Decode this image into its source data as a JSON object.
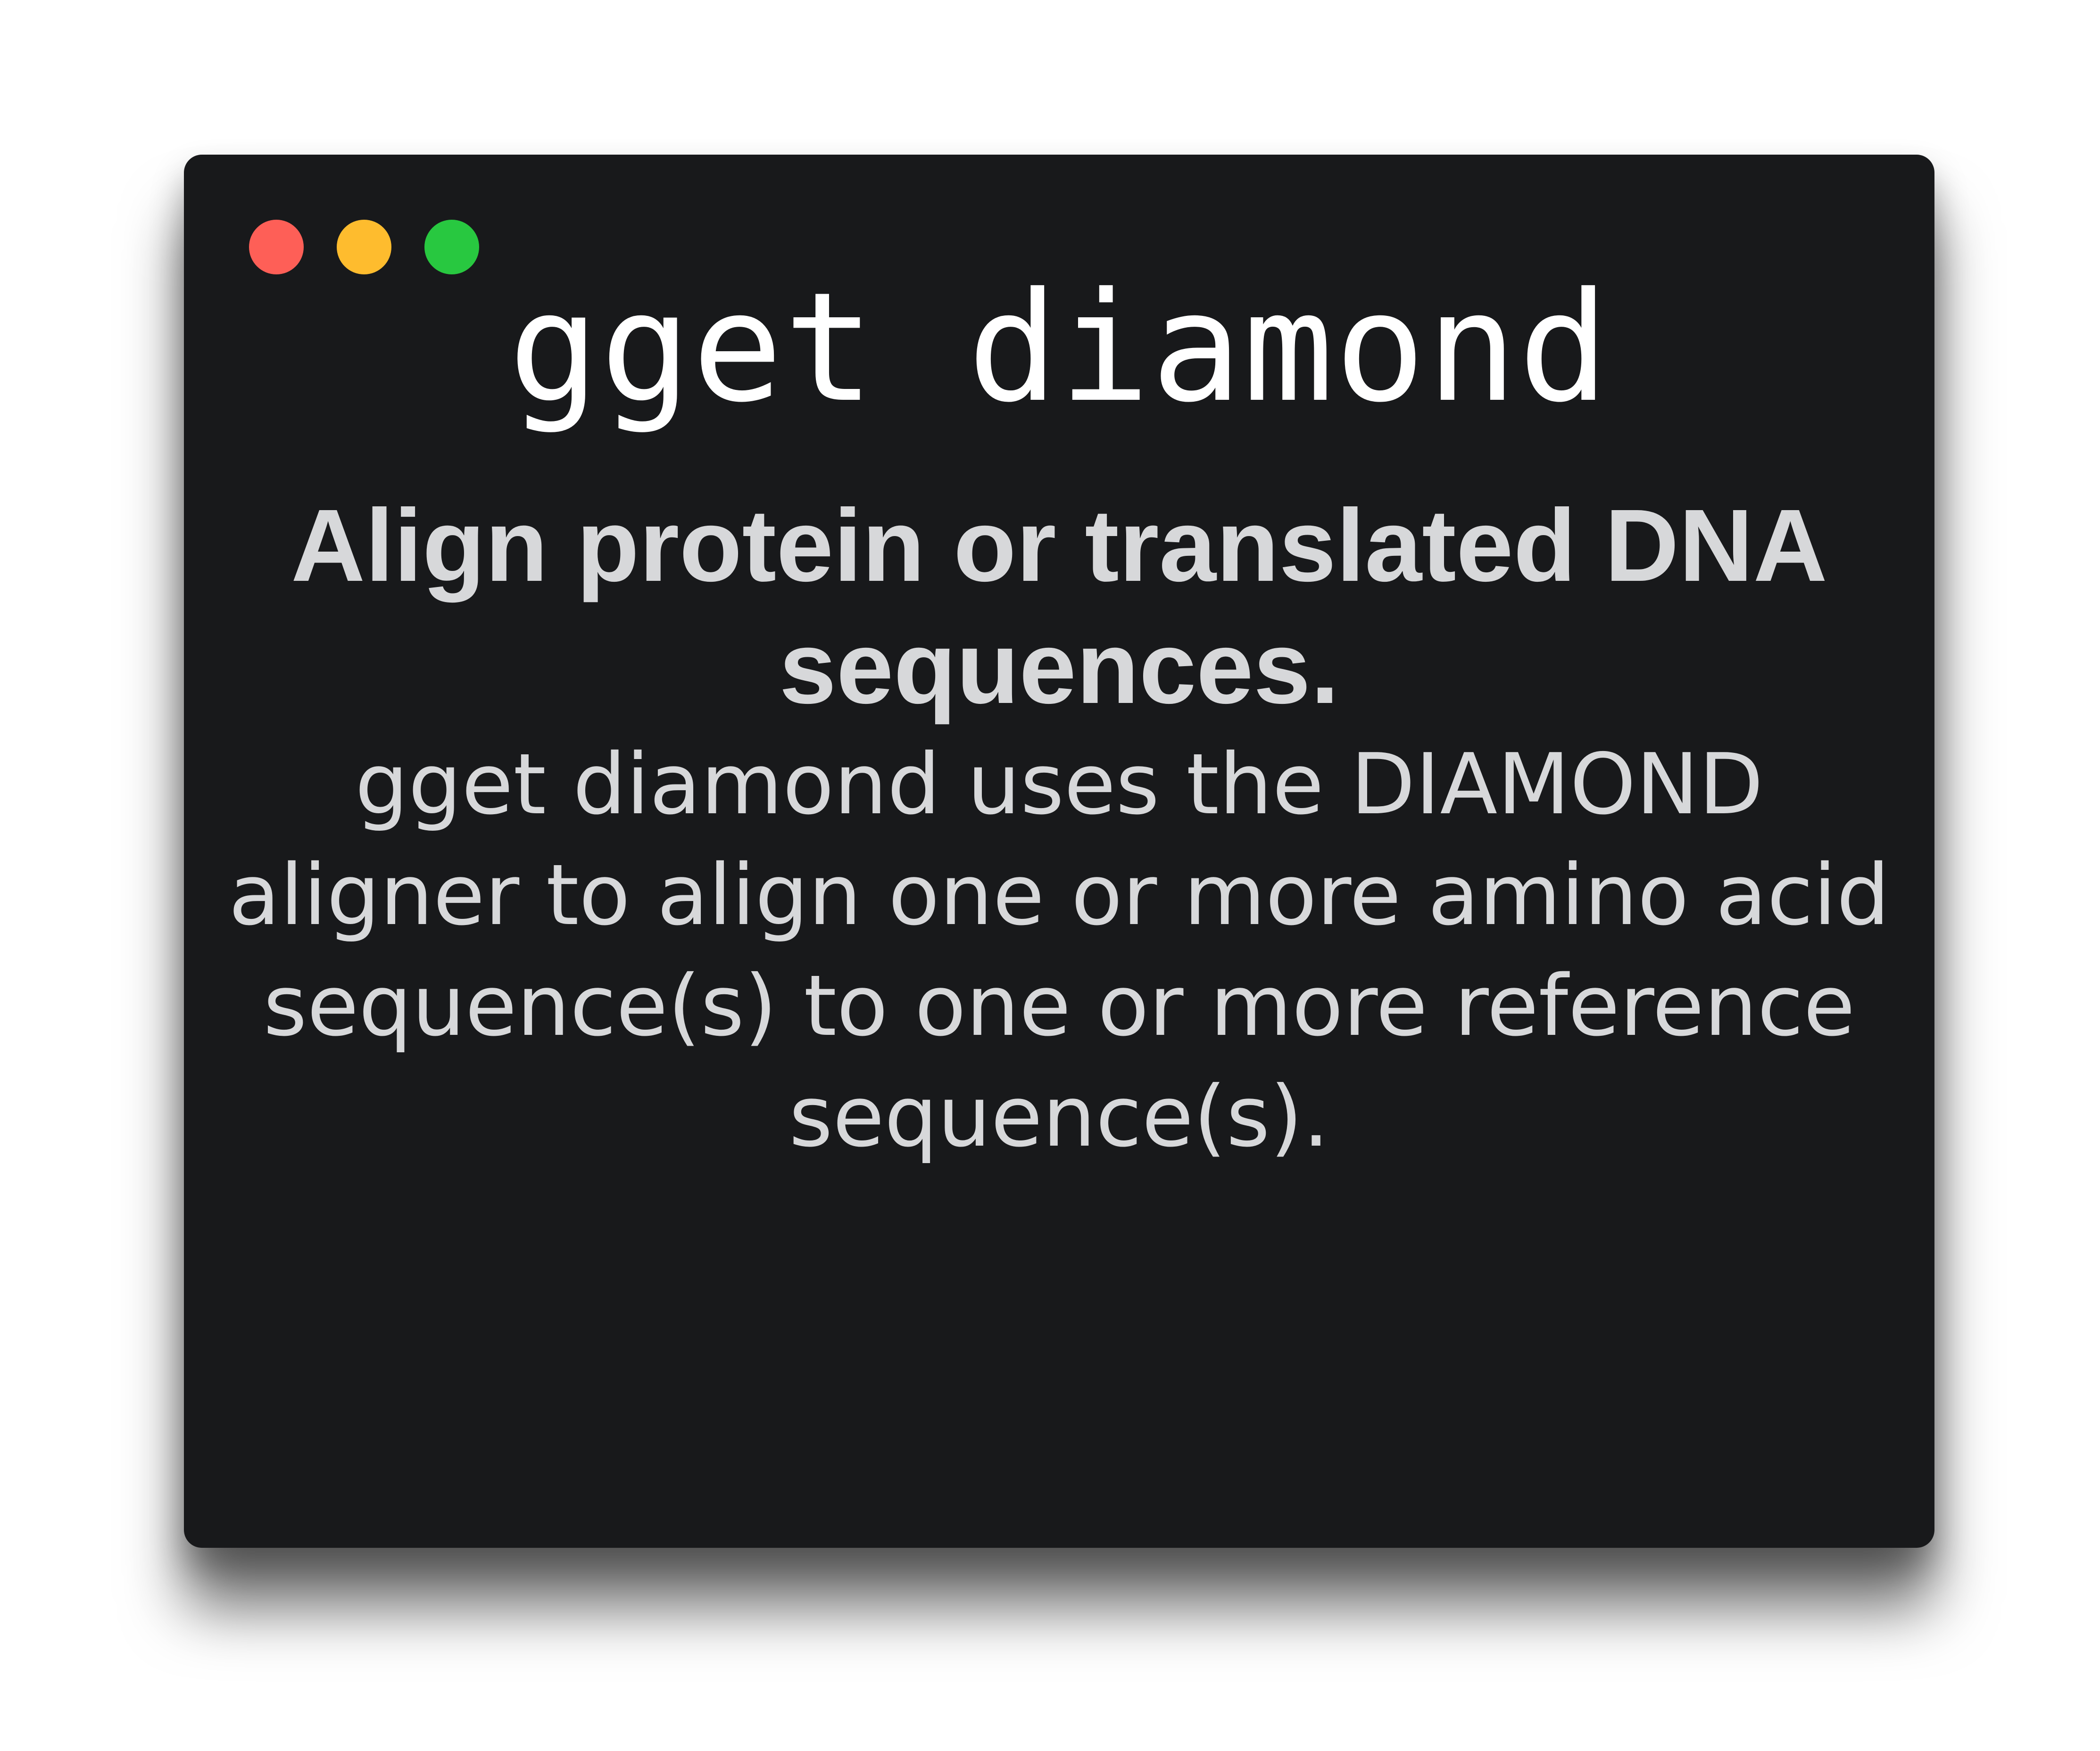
{
  "window": {
    "controls": {
      "close": "red-dot",
      "minimize": "yellow-dot",
      "zoom": "green-dot"
    }
  },
  "title": "gget diamond",
  "headline": "Align protein or translated DNA sequences.",
  "description": "gget diamond uses the DIAMOND aligner to align one or more amino acid sequence(s) to one or more reference sequence(s).",
  "colors": {
    "window_bg": "#18191b",
    "text": "#d7d8da",
    "title_text": "#ffffff",
    "close": "#fe5f57",
    "minimize": "#febc2e",
    "zoom": "#28c840"
  }
}
